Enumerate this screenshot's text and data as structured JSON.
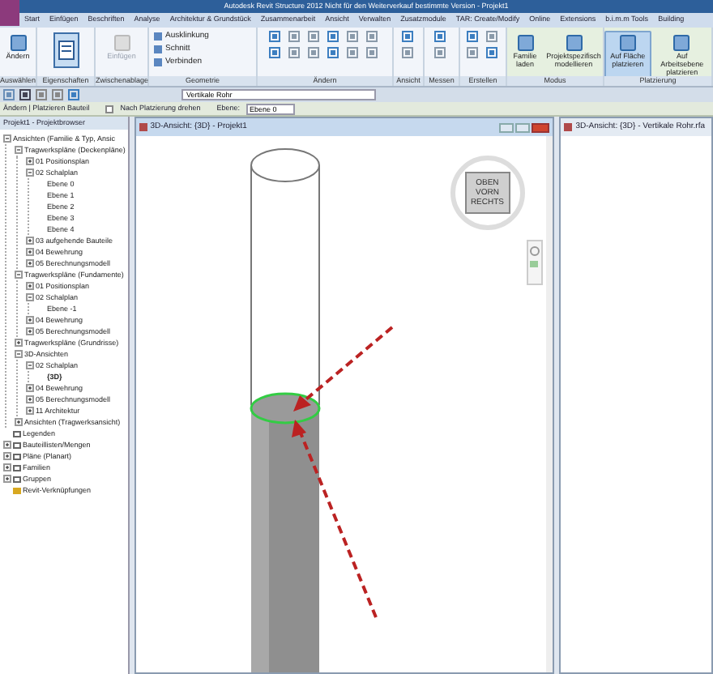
{
  "window": {
    "title": "Autodesk Revit Structure 2012 Nicht für den Weiterverkauf bestimmte Version -   Projekt1"
  },
  "ribbon_tabs": [
    {
      "label": "Start",
      "selected": false
    },
    {
      "label": "Einfügen",
      "selected": false
    },
    {
      "label": "Beschriften",
      "selected": false
    },
    {
      "label": "Analyse",
      "selected": false
    },
    {
      "label": "Architektur & Grundstück",
      "selected": false
    },
    {
      "label": "Zusammenarbeit",
      "selected": false
    },
    {
      "label": "Ansicht",
      "selected": false
    },
    {
      "label": "Verwalten",
      "selected": false
    },
    {
      "label": "Zusatzmodule",
      "selected": false
    },
    {
      "label": "TAR: Create/Modify",
      "selected": false
    },
    {
      "label": "Online",
      "selected": false
    },
    {
      "label": "Extensions",
      "selected": false
    },
    {
      "label": "b.i.m.m Tools",
      "selected": false
    },
    {
      "label": "Building",
      "selected": false
    }
  ],
  "ribbon_panels": [
    {
      "title": "Auswählen",
      "kind": "buttons",
      "buttons": [
        {
          "label": "Ändern",
          "kind": "large",
          "selected": false,
          "disabled": false
        }
      ]
    },
    {
      "title": "Eigenschaften",
      "kind": "buttons",
      "buttons": [
        {
          "kind": "properties",
          "selected": true
        }
      ]
    },
    {
      "title": "Zwischenablage",
      "kind": "buttons",
      "buttons": [
        {
          "label": "Einfügen",
          "kind": "large",
          "selected": false,
          "disabled": true
        }
      ]
    },
    {
      "title": "Geometrie",
      "kind": "buttons",
      "buttons": [
        {
          "label": "Ausklinkung",
          "kind": "small",
          "selected": false,
          "disabled": false
        },
        {
          "label": "Schnitt",
          "kind": "small",
          "selected": false,
          "disabled": false
        },
        {
          "label": "Verbinden",
          "kind": "small",
          "selected": false,
          "disabled": false
        }
      ]
    },
    {
      "title": "Ändern",
      "kind": "tools"
    },
    {
      "title": "Ansicht",
      "kind": "tools"
    },
    {
      "title": "Messen",
      "kind": "tools"
    },
    {
      "title": "Erstellen",
      "kind": "tools"
    },
    {
      "title": "Modus",
      "kind": "buttons",
      "buttons": [
        {
          "label": "Familie laden",
          "kind": "large",
          "selected": false,
          "disabled": false
        },
        {
          "label": "Projektspezifisch modellieren",
          "kind": "large",
          "selected": false,
          "disabled": false
        }
      ]
    },
    {
      "title": "Platzierung",
      "kind": "buttons",
      "buttons": [
        {
          "label": "Auf Fläche platzieren",
          "kind": "large",
          "selected": true,
          "disabled": false
        },
        {
          "label": "Auf Arbeitsebene platzieren",
          "kind": "large",
          "selected": false,
          "disabled": false
        }
      ]
    }
  ],
  "quick_access": {
    "type_selector": "Vertikale Rohr"
  },
  "options_bar": {
    "context": "Ändern | Platzieren Bauteil",
    "rotate_checkbox": {
      "label": "Nach Platzierung drehen",
      "checked": false
    },
    "level_label": "Ebene:",
    "level_value": "Ebene 0"
  },
  "project_browser": {
    "title": "Projekt1 - Projektbrowser",
    "tree": [
      {
        "label": "Ansichten (Familie & Typ, Ansic",
        "expanded": true,
        "children": [
          {
            "label": "Tragwerkspläne (Deckenpläne)",
            "expanded": true,
            "children": [
              {
                "label": "01 Positionsplan",
                "expanded": false
              },
              {
                "label": "02 Schalplan",
                "expanded": true,
                "children": [
                  {
                    "label": "Ebene 0"
                  },
                  {
                    "label": "Ebene 1"
                  },
                  {
                    "label": "Ebene 2"
                  },
                  {
                    "label": "Ebene 3"
                  },
                  {
                    "label": "Ebene 4"
                  }
                ]
              },
              {
                "label": "03 aufgehende Bauteile",
                "expanded": false
              },
              {
                "label": "04 Bewehrung",
                "expanded": false
              },
              {
                "label": "05 Berechnungsmodell",
                "expanded": false
              }
            ]
          },
          {
            "label": "Tragwerkspläne (Fundamente)",
            "expanded": true,
            "children": [
              {
                "label": "01 Positionsplan",
                "expanded": false
              },
              {
                "label": "02 Schalplan",
                "expanded": true,
                "children": [
                  {
                    "label": "Ebene -1"
                  }
                ]
              },
              {
                "label": "04 Bewehrung",
                "expanded": false
              },
              {
                "label": "05 Berechnungsmodell",
                "expanded": false
              }
            ]
          },
          {
            "label": "Tragwerkspläne (Grundrisse)",
            "expanded": false
          },
          {
            "label": "3D-Ansichten",
            "expanded": true,
            "children": [
              {
                "label": "02 Schalplan",
                "expanded": true,
                "children": [
                  {
                    "label": "{3D}",
                    "bold": true
                  }
                ]
              },
              {
                "label": "04 Bewehrung",
                "expanded": false
              },
              {
                "label": "05 Berechnungsmodell",
                "expanded": false
              },
              {
                "label": "11 Architektur",
                "expanded": false
              }
            ]
          },
          {
            "label": "Ansichten (Tragwerksansicht)",
            "expanded": false
          }
        ]
      },
      {
        "label": "Legenden"
      },
      {
        "label": "Bauteillisten/Mengen",
        "expanded": false
      },
      {
        "label": "Pläne (Planart)",
        "expanded": false
      },
      {
        "label": "Familien",
        "expanded": false
      },
      {
        "label": "Gruppen",
        "expanded": false
      },
      {
        "label": "Revit-Verknüpfungen"
      }
    ]
  },
  "views": [
    {
      "title": "3D-Ansicht: {3D} - Projekt1",
      "active": true
    },
    {
      "title": "3D-Ansicht: {3D} - Vertikale Rohr.rfa",
      "active": false
    }
  ],
  "view_cube": {
    "faces": [
      "OBEN",
      "VORN",
      "RECHTS"
    ]
  }
}
